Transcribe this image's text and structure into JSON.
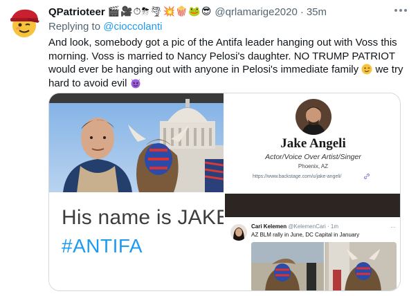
{
  "tweet": {
    "display_name": "QPatrioteer",
    "name_emojis": "🎬🎥⏱⛈🌪💥🍿🐸😎",
    "handle": "@qrlamarige2020",
    "separator": "·",
    "time": "35m",
    "reply_prefix": "Replying to",
    "reply_to": "@cioccolanti",
    "body_part1": "And look, somebody got a pic of the Antifa leader hanging out with Voss this morning. Voss is married to Nancy Pelosi's daughter. NO TRUMP PATRIOT would ever be hanging out with anyone in Pelosi's immediate family",
    "body_part2": " we try hard to avoid evil",
    "emoji_wink": "wink-emoji",
    "emoji_devil": "smiling-imp-emoji"
  },
  "media": {
    "text_card": {
      "name_line": "His name is JAKE",
      "hashtag": "#ANTIFA"
    },
    "profile_card": {
      "name": "Jake Angeli",
      "role": "Actor/Voice Over Artist/Singer",
      "location": "Phoenix, AZ",
      "url": "https://www.backstage.com/u/jake-angeli/"
    },
    "quoted_tweet": {
      "name": "Cari Kelemen",
      "handle": "@KelemenCari",
      "age": "· 1m",
      "text": "AZ BLM rally in June, DC Capital in January",
      "more": "···"
    }
  },
  "colors": {
    "link": "#1d9bf0",
    "secondary_text": "#536471",
    "border": "#cfd9de"
  }
}
